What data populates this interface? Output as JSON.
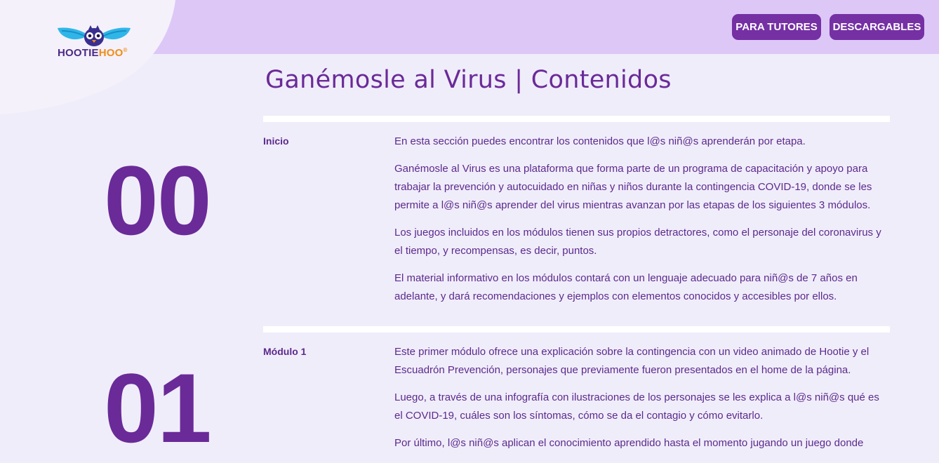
{
  "logo": {
    "text_part1": "HOOTIE",
    "text_part2": "HOO",
    "mark": "®"
  },
  "nav": {
    "tutores": "PARA TUTORES",
    "descargables": "DESCARGABLES"
  },
  "title": "Ganémosle al Virus | Contenidos",
  "sections": [
    {
      "number": "00",
      "label": "Inicio",
      "paragraphs": [
        "En esta sección puedes encontrar los contenidos que l@s niñ@s aprenderán por etapa.",
        "Ganémosle al Virus es una plataforma que forma parte de un programa de capacitación y apoyo para trabajar la prevención y autocuidado en niñas y niños durante la contingencia COVID-19, donde se les permite a l@s niñ@s aprender del virus mientras avanzan por las etapas de los siguientes 3 módulos.",
        "Los juegos incluidos en los módulos tienen sus propios detractores, como el personaje del coronavirus y el tiempo, y recompensas, es decir, puntos.",
        "El material informativo en los módulos contará con un lenguaje adecuado para niñ@s de 7 años en adelante, y dará recomendaciones y ejemplos con elementos conocidos y accesibles por ellos."
      ]
    },
    {
      "number": "01",
      "label": "Módulo 1",
      "paragraphs": [
        "Este primer módulo ofrece una explicación sobre la contingencia con un video animado de Hootie y el Escuadrón Prevención, personajes que previamente fueron presentados en el home de la página.",
        "Luego, a través de una infografía con ilustraciones de los personajes se les explica a l@s niñ@s qué es el COVID-19, cuáles son los síntomas, cómo se da el contagio y cómo evitarlo.",
        "Por último, l@s niñ@s aplican el conocimiento aprendido hasta el momento jugando un juego donde"
      ]
    }
  ],
  "colors": {
    "page_bg": "#f0edfa",
    "header_bg": "#dcc7f7",
    "accent": "#7530a4",
    "text": "#5b2a8c",
    "logo_orange": "#f28c16"
  },
  "icons": {
    "logo_mark": "owl-logo-icon"
  }
}
